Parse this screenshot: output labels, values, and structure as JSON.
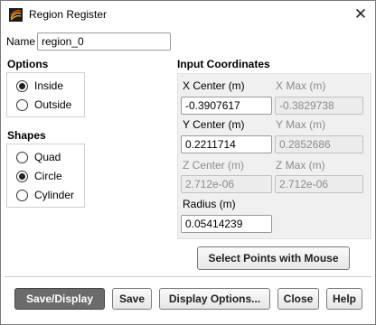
{
  "window": {
    "title": "Region Register",
    "close_glyph": "✕"
  },
  "name": {
    "label": "Name",
    "value": "region_0"
  },
  "options": {
    "heading": "Options",
    "items": [
      {
        "label": "Inside",
        "selected": true
      },
      {
        "label": "Outside",
        "selected": false
      }
    ]
  },
  "shapes": {
    "heading": "Shapes",
    "items": [
      {
        "label": "Quad",
        "selected": false
      },
      {
        "label": "Circle",
        "selected": true
      },
      {
        "label": "Cylinder",
        "selected": false
      }
    ]
  },
  "coords": {
    "heading": "Input Coordinates",
    "x_center": {
      "label": "X Center (m)",
      "value": "-0.3907617"
    },
    "x_max": {
      "label": "X Max (m)",
      "value": "-0.3829738"
    },
    "y_center": {
      "label": "Y Center (m)",
      "value": "0.2211714"
    },
    "y_max": {
      "label": "Y Max (m)",
      "value": "0.2852686"
    },
    "z_center": {
      "label": "Z Center (m)",
      "value": "2.712e-06"
    },
    "z_max": {
      "label": "Z Max (m)",
      "value": "2.712e-06"
    },
    "radius": {
      "label": "Radius (m)",
      "value": "0.05414239"
    }
  },
  "select_points_label": "Select Points with Mouse",
  "buttons": {
    "save_display": "Save/Display",
    "save": "Save",
    "display_options": "Display Options...",
    "close": "Close",
    "help": "Help"
  },
  "colors": {
    "primary_button": "#6b6b6b",
    "disabled_text": "#8c8c8c"
  }
}
